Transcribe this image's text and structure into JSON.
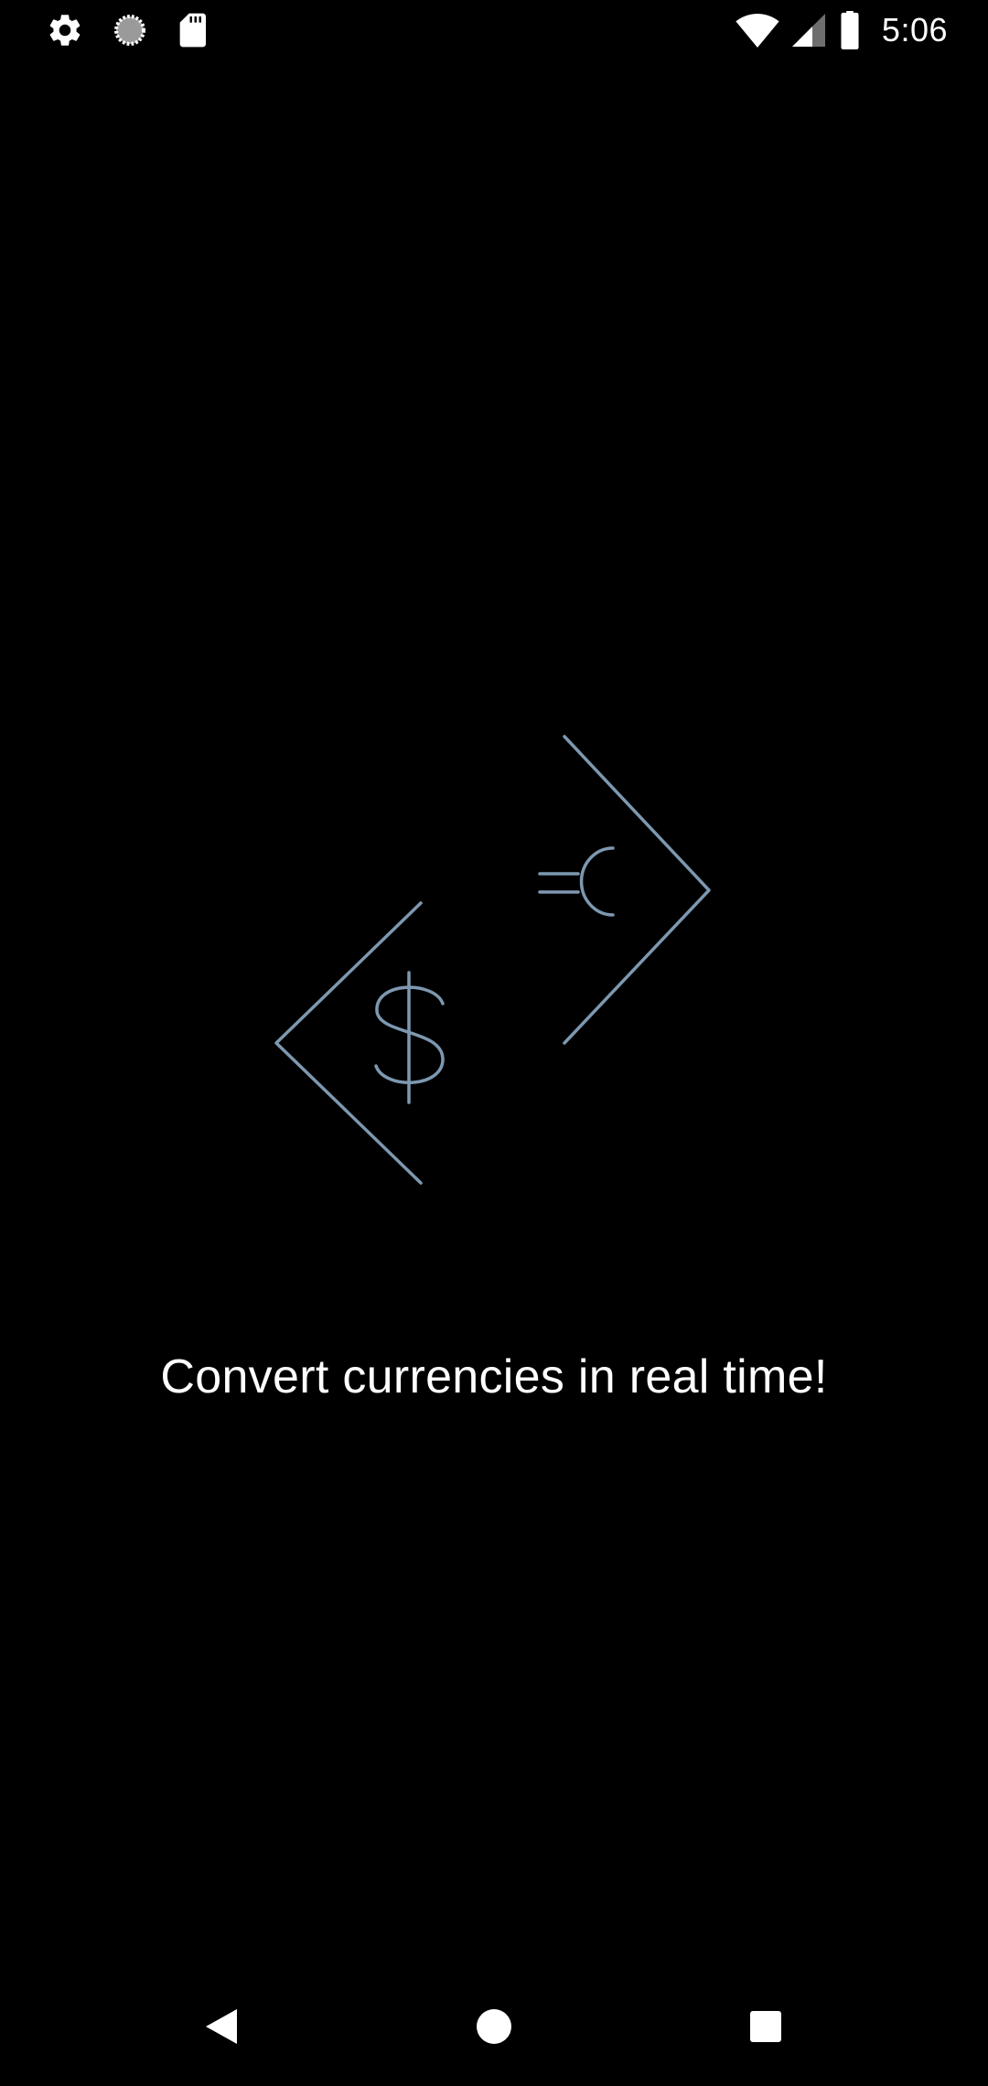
{
  "status_bar": {
    "time": "5:06",
    "left_icons": [
      "settings-icon",
      "sync-icon",
      "sd-card-icon"
    ],
    "right_icons": [
      "wifi-icon",
      "cellular-signal-icon",
      "battery-icon"
    ],
    "icon_color": "#ffffff"
  },
  "splash": {
    "logo_icon": "currency-exchange-icon",
    "logo_color": "#7d98b0",
    "tagline": "Convert currencies in real time!"
  },
  "navigation_bar": {
    "buttons": [
      "back-icon",
      "home-icon",
      "recents-icon"
    ],
    "color": "#ffffff"
  }
}
